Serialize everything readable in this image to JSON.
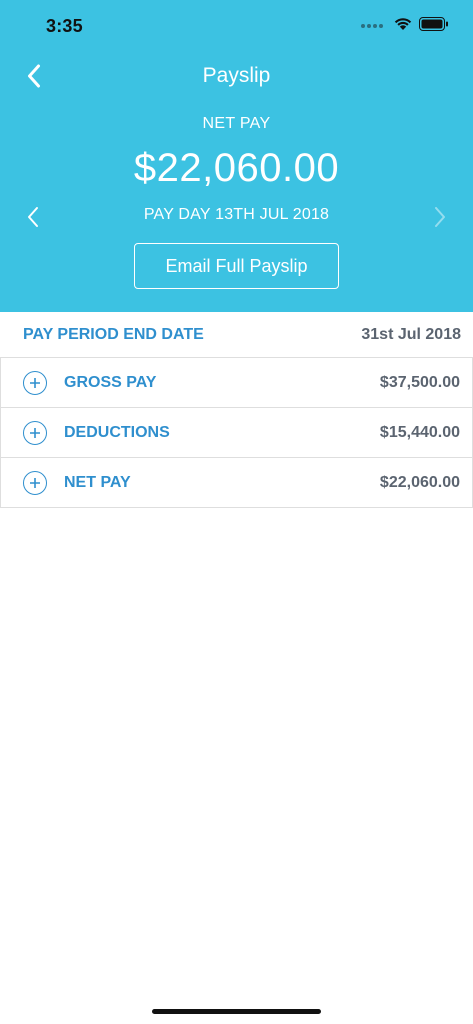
{
  "status_bar": {
    "time": "3:35",
    "icons": [
      "cellular-signal-icon",
      "wifi-icon",
      "battery-icon"
    ]
  },
  "nav": {
    "title": "Payslip",
    "back_icon": "chevron-left-icon"
  },
  "summary": {
    "net_pay_label": "NET PAY",
    "net_pay_amount": "$22,060.00",
    "pay_day": "PAY DAY 13TH JUL 2018",
    "prev_icon": "chevron-left-icon",
    "next_icon": "chevron-right-icon",
    "email_button": "Email Full Payslip"
  },
  "period": {
    "label": "PAY PERIOD END DATE",
    "value": "31st Jul 2018"
  },
  "rows": [
    {
      "label": "GROSS PAY",
      "value": "$37,500.00",
      "icon": "plus-circle-icon"
    },
    {
      "label": "DEDUCTIONS",
      "value": "$15,440.00",
      "icon": "plus-circle-icon"
    },
    {
      "label": "NET PAY",
      "value": "$22,060.00",
      "icon": "plus-circle-icon"
    }
  ],
  "colors": {
    "header_bg": "#3cc2e2",
    "accent": "#2f8fce",
    "value_text": "#5b6470",
    "divider": "#dedede"
  }
}
